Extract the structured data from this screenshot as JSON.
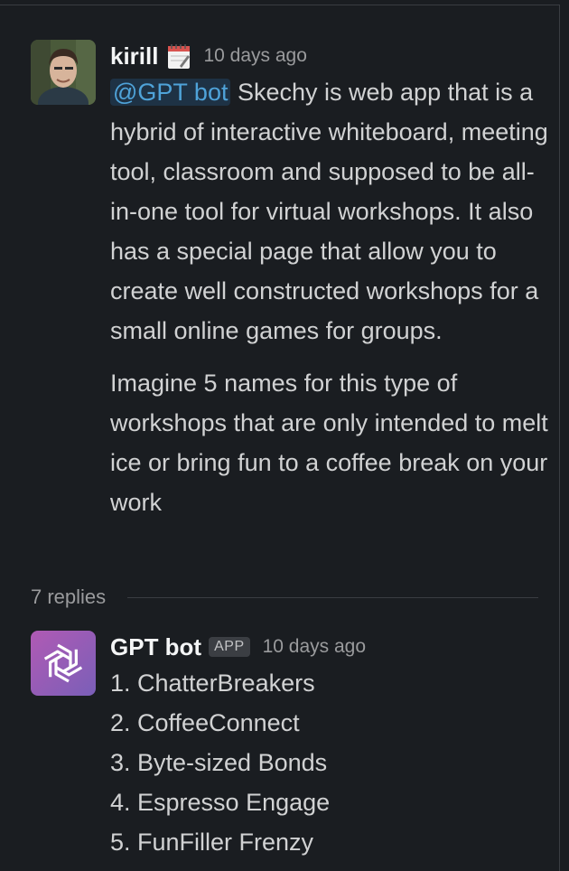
{
  "thread": {
    "root": {
      "author": "kirill",
      "status_icon": "calendar-notepad-icon",
      "timestamp": "10 days ago",
      "mention": "@GPT bot",
      "paragraph1_rest": " Skechy is web app that is a hybrid of interactive whiteboard, meeting tool, classroom and supposed to be all-in-one tool for virtual workshops. It also has a special page that allow you to create well constructed workshops for a small online games for groups.",
      "paragraph2": "Imagine 5 names for this type of workshops that are only intended to melt ice or bring fun to a coffee break on your work"
    },
    "replies_label": "7 replies",
    "reply": {
      "author": "GPT bot",
      "badge": "APP",
      "timestamp": "10 days ago",
      "avatar_icon": "openai-logo-icon",
      "avatar_color": "#9b5cb4",
      "items": [
        "1. ChatterBreakers",
        "2. CoffeeConnect",
        "3. Byte-sized Bonds",
        "4. Espresso Engage",
        "5. FunFiller Frenzy"
      ]
    }
  }
}
